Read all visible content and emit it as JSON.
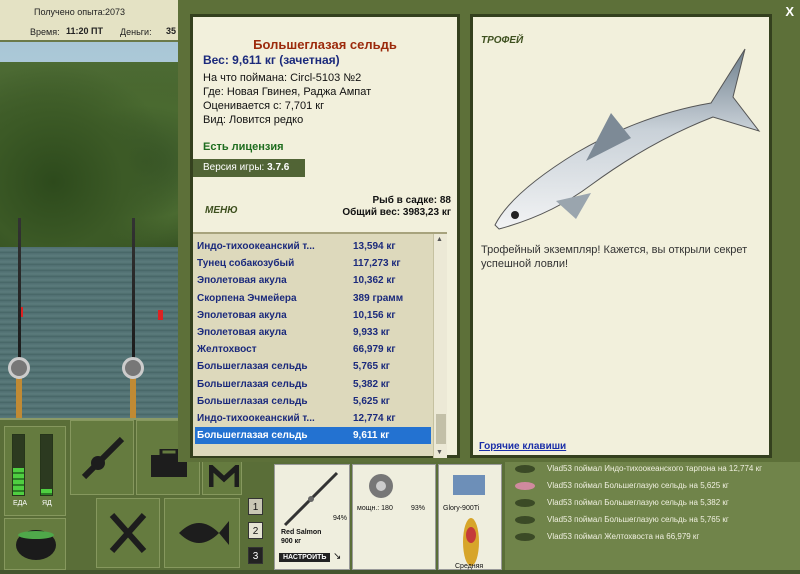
{
  "topbar": {
    "xp_label": "Получено опыта:",
    "xp_value": "2073",
    "time_label": "Время:",
    "time_value": "11:20 ПТ",
    "money_label": "Деньги:",
    "money_value": "35"
  },
  "fish": {
    "name": "Большеглазая сельдь",
    "weight_line": "Вес: 9,611 кг (зачетная)",
    "bait_line": "На что поймана: Circl-5103 №2",
    "location_line": "Где: Новая Гвинея, Раджа Ампат",
    "value_line": "Оценивается с: 7,701 кг",
    "rarity_line": "Вид: Ловится редко"
  },
  "license": "Есть лицензия",
  "version": {
    "label": "Версия игры:",
    "value": "3.7.6"
  },
  "menu_label": "МЕНЮ",
  "keepnet": {
    "count_line": "Рыб в садке: 88",
    "total_line": "Общий вес: 3983,23 кг"
  },
  "catch_list": [
    {
      "name": "Индо-тихоокеанский т...",
      "weight": "13,594 кг"
    },
    {
      "name": "Тунец собакозубый",
      "weight": "117,273 кг"
    },
    {
      "name": "Эполетовая акула",
      "weight": "10,362 кг"
    },
    {
      "name": "Скорпена Эчмейера",
      "weight": "389 грамм"
    },
    {
      "name": "Эполетовая акула",
      "weight": "10,156 кг"
    },
    {
      "name": "Эполетовая акула",
      "weight": "9,933 кг"
    },
    {
      "name": "Желтохвост",
      "weight": "66,979 кг"
    },
    {
      "name": "Большеглазая сельдь",
      "weight": "5,765 кг"
    },
    {
      "name": "Большеглазая сельдь",
      "weight": "5,382 кг"
    },
    {
      "name": "Большеглазая сельдь",
      "weight": "5,625 кг"
    },
    {
      "name": "Индо-тихоокеанский т...",
      "weight": "12,774 кг"
    },
    {
      "name": "Большеглазая сельдь",
      "weight": "9,611 кг"
    }
  ],
  "selected_index": 11,
  "trophy": {
    "title": "ТРОФЕЙ",
    "text": "Трофейный экземпляр! Кажется, вы открыли секрет успешной ловли!",
    "hotkeys": "Горячие клавиши"
  },
  "close_label": "X",
  "gauges": {
    "food_label": "ЕДА",
    "poison_label": "ЯД",
    "food_level": 0.45,
    "poison_level": 0.1
  },
  "slots": {
    "num1": "1",
    "num2": "2",
    "num3": "3"
  },
  "tackle": {
    "rod_name": "Red Salmon",
    "rod_weight": "900 кг",
    "rod_pct": "94%",
    "reel_label": "мощн.: 180",
    "reel_pct": "93%",
    "line_name": "Glory-900Ti",
    "lure_label": "Средняя",
    "setup_button": "НАСТРОИТЬ"
  },
  "log": [
    "Vlad53 поймал Индо-тихоокеанского тарпона на 12,774 кг",
    "Vlad53 поймал Большеглазую сельдь на 5,625 кг",
    "Vlad53 поймал Большеглазую сельдь на 5,382 кг",
    "Vlad53 поймал Большеглазую сельдь на 5,765 кг",
    "Vlad53 поймал Желтохвоста на 66,979 кг"
  ],
  "colors": {
    "panel_bg": "#f2f0dc",
    "frame": "#5d7039",
    "fish_title": "#9c2a0c",
    "catch_text": "#1b2a7c",
    "selection": "#2372d1",
    "license_green": "#1f6d1f"
  }
}
